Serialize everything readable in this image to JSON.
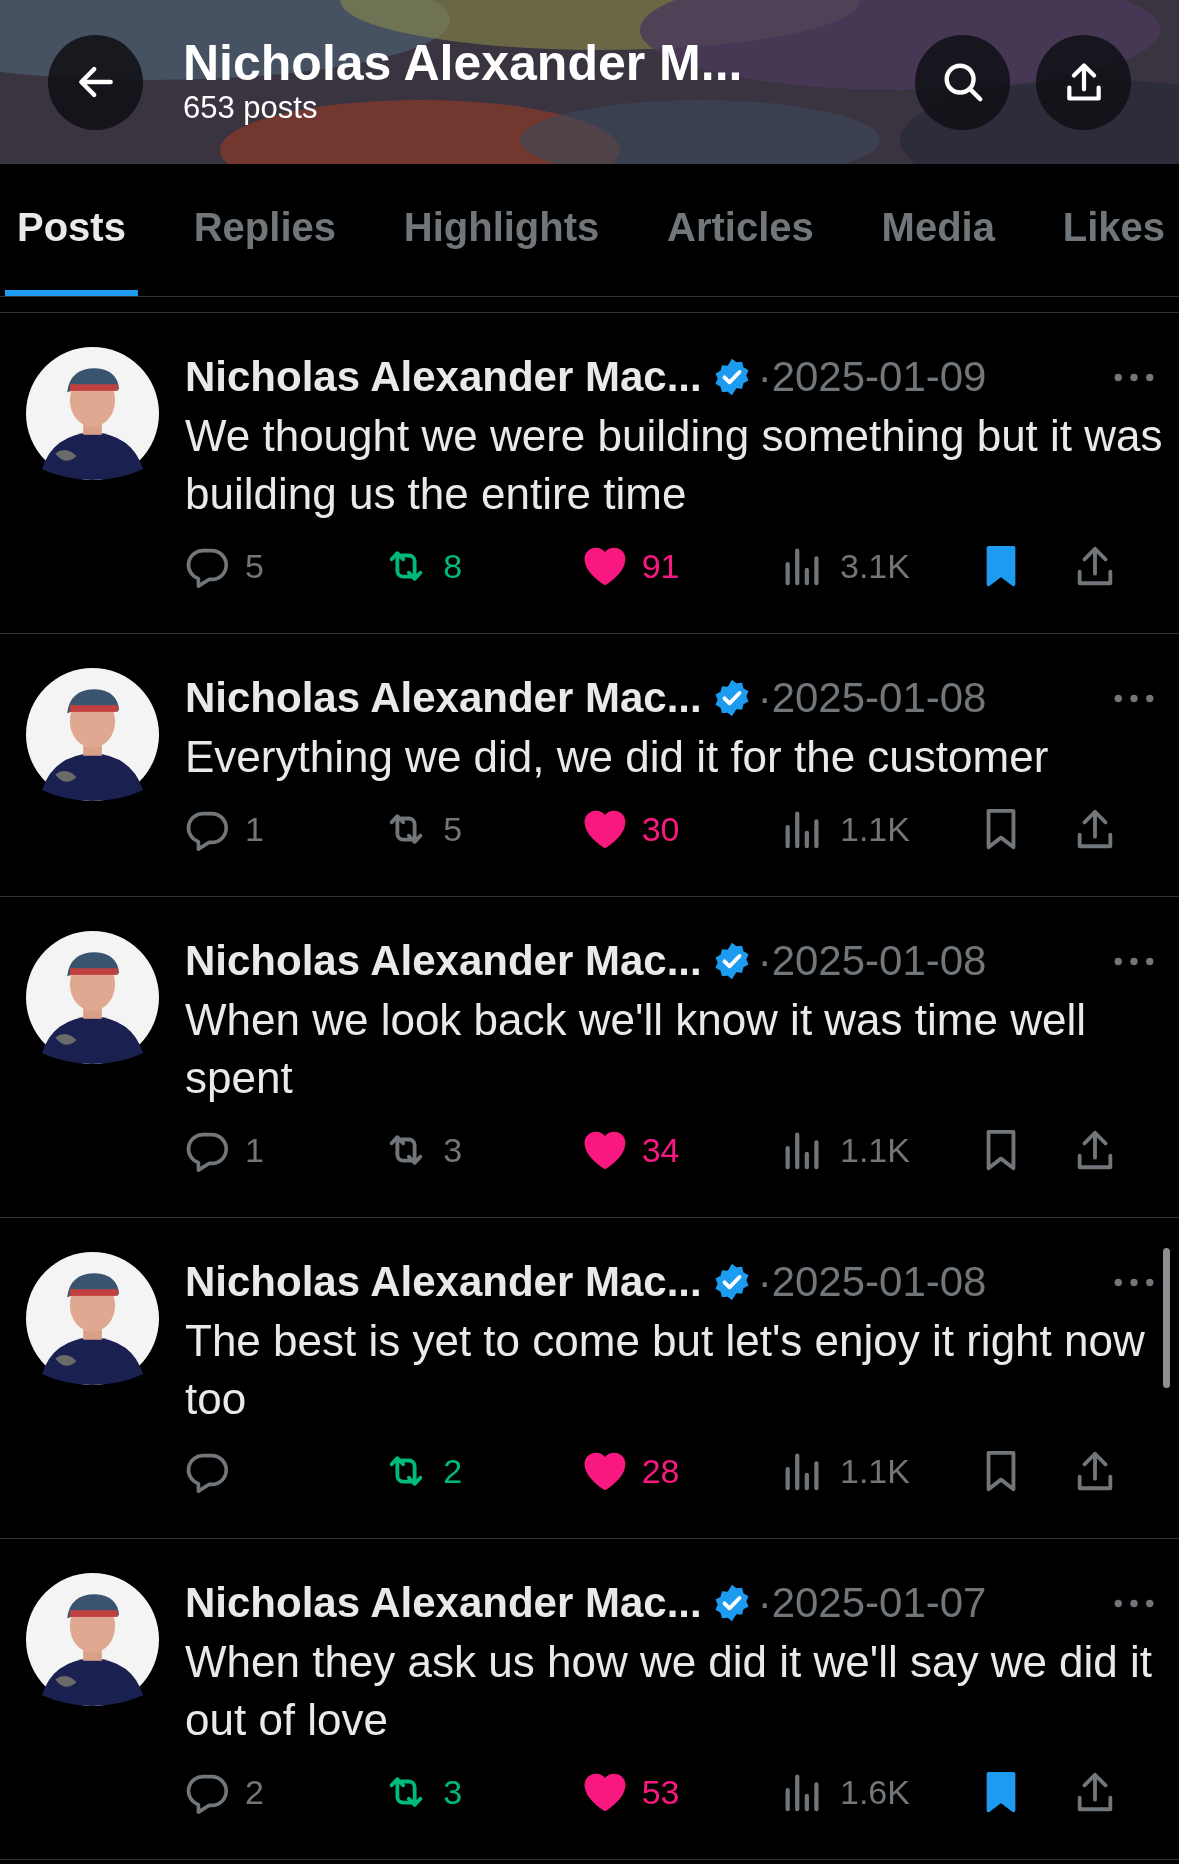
{
  "header": {
    "title": "Nicholas Alexander M...",
    "subtitle": "653 posts"
  },
  "tabs": [
    {
      "label": "Posts",
      "selected": true
    },
    {
      "label": "Replies",
      "selected": false
    },
    {
      "label": "Highlights",
      "selected": false
    },
    {
      "label": "Articles",
      "selected": false
    },
    {
      "label": "Media",
      "selected": false
    },
    {
      "label": "Likes",
      "selected": false
    }
  ],
  "posts": [
    {
      "name": "Nicholas Alexander Mac...",
      "verified": true,
      "date": "·2025-01-09",
      "text": "We thought we were building something but it was building us the entire time",
      "replies": "5",
      "reposts": "8",
      "reposted": true,
      "likes": "91",
      "liked": true,
      "views": "3.1K",
      "bookmarked": true
    },
    {
      "name": "Nicholas Alexander Mac...",
      "verified": true,
      "date": "·2025-01-08",
      "text": "Everything we did, we did it for the customer",
      "replies": "1",
      "reposts": "5",
      "reposted": false,
      "likes": "30",
      "liked": true,
      "views": "1.1K",
      "bookmarked": false
    },
    {
      "name": "Nicholas Alexander Mac...",
      "verified": true,
      "date": "·2025-01-08",
      "text": "When we look back we'll know it was time well spent",
      "replies": "1",
      "reposts": "3",
      "reposted": false,
      "likes": "34",
      "liked": true,
      "views": "1.1K",
      "bookmarked": false
    },
    {
      "name": "Nicholas Alexander Mac...",
      "verified": true,
      "date": "·2025-01-08",
      "text": "The best is yet to come but let's enjoy it right now too",
      "reposts": "2",
      "reposted": true,
      "likes": "28",
      "liked": true,
      "views": "1.1K",
      "bookmarked": false
    },
    {
      "name": "Nicholas Alexander Mac...",
      "verified": true,
      "date": "·2025-01-07",
      "text": "When they ask us how we did it we'll say we did it out of love",
      "replies": "2",
      "reposts": "3",
      "reposted": true,
      "likes": "53",
      "liked": true,
      "views": "1.6K",
      "bookmarked": true
    }
  ]
}
